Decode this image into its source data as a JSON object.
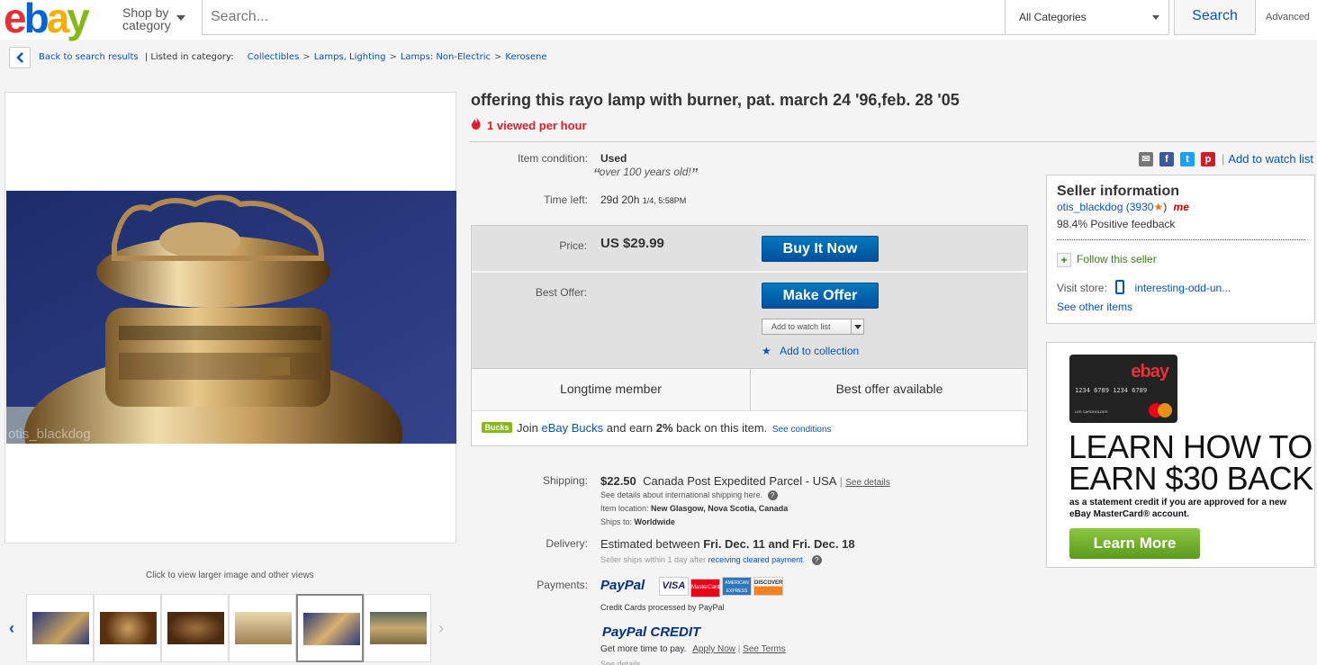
{
  "header": {
    "logo_e": "e",
    "logo_b": "b",
    "logo_a": "a",
    "logo_y": "y",
    "shop_by_line1": "Shop by",
    "shop_by_line2": "category",
    "search_placeholder": "Search...",
    "category_select": "All Categories",
    "search_button": "Search",
    "advanced": "Advanced"
  },
  "breadcrumb": {
    "back": "Back to search results",
    "listed_in": "| Listed in category:",
    "crumbs": [
      "Collectibles",
      "Lamps, Lighting",
      "Lamps: Non-Electric",
      "Kerosene"
    ],
    "separator": ">"
  },
  "gallery": {
    "watermark": "otis_blackdog",
    "click_hint": "Click to view larger image and other views",
    "prev_icon": "chevron-left-icon",
    "next_icon": "chevron-right-icon"
  },
  "item": {
    "title": "offering this rayo lamp with burner, pat. march 24 '96,feb. 28 '05",
    "views": "1 viewed per hour",
    "condition_label": "Item condition:",
    "condition_value": "Used",
    "condition_quote": "over 100 years old!",
    "quote_open": "“",
    "quote_close": "”",
    "time_left_label": "Time left:",
    "time_left_value": "29d 20h",
    "time_left_detail": "1/4, 5:58PM"
  },
  "purchase": {
    "price_label": "Price:",
    "price_value": "US $29.99",
    "buy_now": "Buy It Now",
    "best_offer_label": "Best Offer:",
    "make_offer": "Make Offer",
    "add_watch": "Add to watch list",
    "add_collection": "Add to collection",
    "badge_1": "Longtime member",
    "badge_2": "Best offer available",
    "bucks_logo": "Bucks",
    "bucks_join": "Join",
    "bucks_link": "eBay Bucks",
    "bucks_earn": "and earn",
    "bucks_pct": "2%",
    "bucks_back": "back on this item.",
    "bucks_conditions": "See conditions"
  },
  "shipping": {
    "label": "Shipping:",
    "cost": "$22.50",
    "method": "Canada Post Expedited Parcel - USA",
    "divider": "|",
    "see_details": "See details",
    "intl": "See details about international shipping here.",
    "location_label": "Item location:",
    "location": "New Glasgow, Nova Scotia, Canada",
    "ships_to_label": "Ships to:",
    "ships_to": "Worldwide"
  },
  "delivery": {
    "label": "Delivery:",
    "estimated": "Estimated between",
    "dates": "Fri. Dec. 11 and Fri. Dec. 18",
    "ships_within": "Seller ships within 1 day after",
    "cleared_link": "receiving cleared payment",
    "period": "."
  },
  "payments": {
    "label": "Payments:",
    "paypal": "PayPal",
    "cards": [
      "VISA",
      "MasterCard",
      "AMERICAN EXPRESS",
      "DISCOVER"
    ],
    "processed": "Credit Cards processed by PayPal",
    "paypal_credit": "PayPal CREDIT",
    "more_time": "Get more time to pay.",
    "apply_now": "Apply Now",
    "sep": "|",
    "see_terms": "See Terms",
    "see_details": "See details"
  },
  "sidebar": {
    "share_icons": [
      "email-icon",
      "facebook-icon",
      "twitter-icon",
      "pinterest-icon"
    ],
    "share_sep": "|",
    "watch_link": "Add to watch list",
    "seller_heading": "Seller information",
    "seller_name": "otis_blackdog",
    "seller_score": "(3930",
    "seller_close": ")",
    "me_badge": "me",
    "feedback": "98.4% Positive feedback",
    "follow": "Follow this seller",
    "visit_store": "Visit store:",
    "store_name": "interesting-odd-un...",
    "other_items": "See other items"
  },
  "ad": {
    "card_logo": "ebay",
    "card_number": "1234 6789 1234 6789",
    "card_name": "LEE CARDHOLDER",
    "headline_1": "LEARN HOW TO",
    "headline_2": "EARN $30 BACK",
    "subtext": "as a statement credit if you are approved for a new eBay MasterCard® account.",
    "button": "Learn More"
  }
}
